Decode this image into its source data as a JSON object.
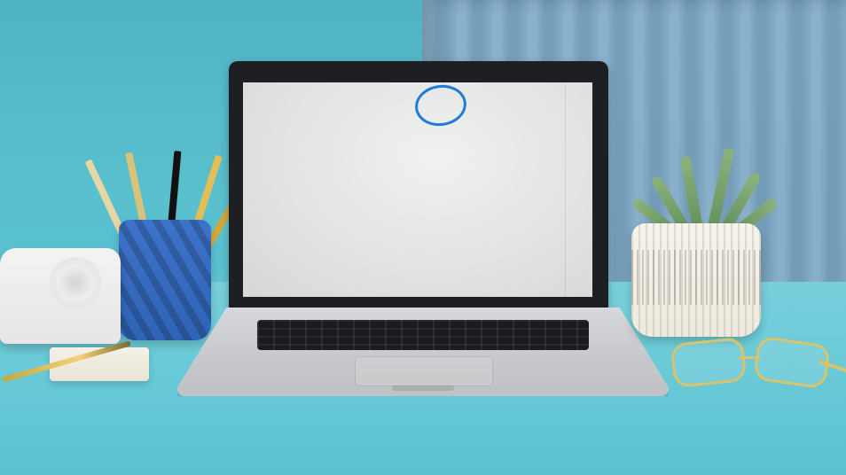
{
  "scene": {
    "colors": {
      "wall": "#56b4c6",
      "curtain": "#7ea9c6",
      "desk": "#6ccbd8",
      "screen_annotation": "#1e7bd7"
    },
    "objects": [
      "laptop",
      "pencil-cup",
      "tape-dispenser",
      "sticky-notes",
      "pen",
      "potted-plant",
      "glasses"
    ]
  }
}
